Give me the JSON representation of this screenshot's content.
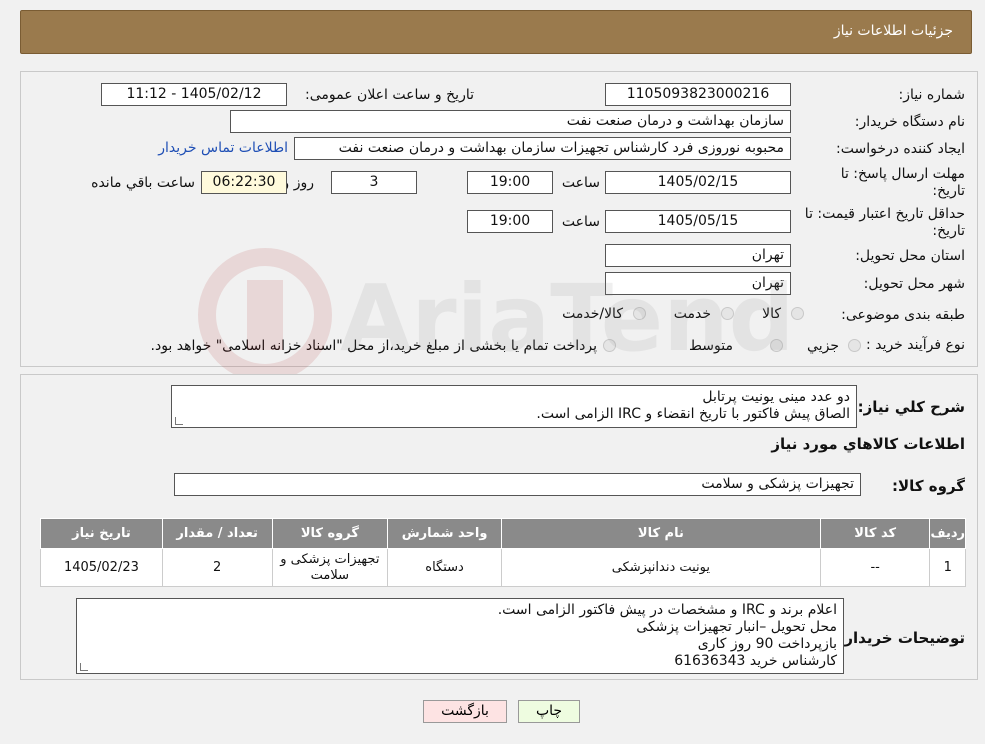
{
  "header": {
    "title": "جزئیات اطلاعات نیاز"
  },
  "labels": {
    "need_number": "شماره نیاز:",
    "announce_datetime": "تاریخ و ساعت اعلان عمومی:",
    "buyer_org": "نام دستگاه خریدار:",
    "requester": "ایجاد کننده درخواست:",
    "reply_deadline": "مهلت ارسال پاسخ: تا تاریخ:",
    "hour": "ساعت",
    "day_and": "روز و",
    "remaining": "ساعت باقي مانده",
    "price_validity": "حداقل تاریخ اعتبار قیمت: تا تاریخ:",
    "delivery_province": "استان محل تحویل:",
    "delivery_city": "شهر محل تحویل:",
    "category": "طبقه بندی موضوعی:",
    "purchase_type": "نوع فرآیند خرید :",
    "general_desc": "شرح كلي نياز:",
    "goods_info": "اطلاعات كالاهاي مورد نياز",
    "goods_group": "گروه کالا:",
    "buyer_notes": "توضیحات خریدار:"
  },
  "fields": {
    "need_number": "1105093823000216",
    "announce_datetime": "1405/02/12 - 11:12",
    "buyer_org": "سازمان بهداشت و درمان صنعت نفت",
    "requester": "محبوبه نوروزی فرد کارشناس تجهیزات سازمان بهداشت و درمان صنعت نفت",
    "contact_link": "اطلاعات تماس خریدار",
    "reply_date": "1405/02/15",
    "reply_time": "19:00",
    "days": "3",
    "remaining_time": "06:22:30",
    "validity_date": "1405/05/15",
    "validity_time": "19:00",
    "province": "تهران",
    "city": "تهران",
    "goods_group": "تجهیزات پزشکی و سلامت"
  },
  "category_options": [
    "کالا",
    "خدمت",
    "کالا/خدمت"
  ],
  "purchase_options": [
    "جزیي",
    "متوسط"
  ],
  "purchase_note": "پرداخت تمام یا بخشی از مبلغ خرید،از محل \"اسناد خزانه اسلامی\" خواهد بود.",
  "general_desc": {
    "line1": "دو عدد مینی یونیت پرتابل",
    "line2": "الصاق پیش فاکتور با تاریخ انقضاء و IRC الزامی است."
  },
  "table": {
    "headers": [
      "ردیف",
      "کد کالا",
      "نام کالا",
      "واحد شمارش",
      "گروه کالا",
      "تعداد / مقدار",
      "تاریخ نیاز"
    ],
    "rows": [
      [
        "1",
        "--",
        "یونیت دندانپزشکی",
        "دستگاه",
        "تجهیزات پزشکی و سلامت",
        "2",
        "1405/02/23"
      ]
    ]
  },
  "buyer_notes": {
    "line1": "اعلام برند و IRC  و مشخصات در پیش فاکتور الزامی است.",
    "line2": "محل تحویل –انبار تجهیزات پزشکی",
    "line3": "بازپرداخت 90 روز کاری",
    "line4": "کارشناس خرید  61636343"
  },
  "buttons": {
    "print": "چاپ",
    "back": "بازگشت"
  },
  "colors": {
    "header_bg": "#9a7a4d",
    "print_btn": "#eefce0",
    "back_btn": "#fde3e3",
    "link": "#1f4fb5",
    "timer_bg": "#fffadc"
  },
  "icons": {
    "watermark": "ariatender-logo"
  }
}
